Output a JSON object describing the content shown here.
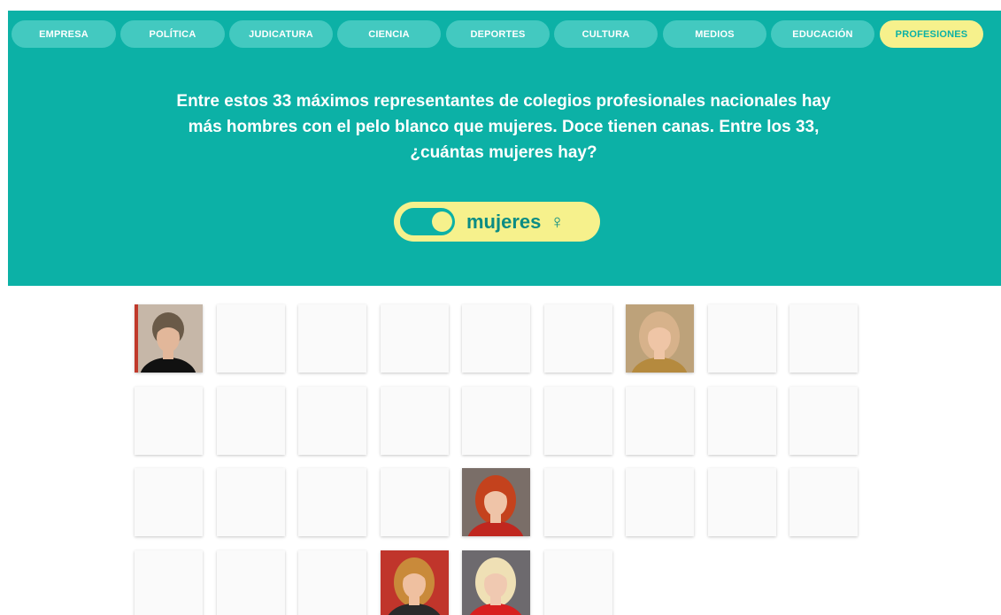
{
  "tabs": [
    {
      "label": "EMPRESA",
      "active": false
    },
    {
      "label": "POLÍTICA",
      "active": false
    },
    {
      "label": "JUDICATURA",
      "active": false
    },
    {
      "label": "CIENCIA",
      "active": false
    },
    {
      "label": "DEPORTES",
      "active": false
    },
    {
      "label": "CULTURA",
      "active": false
    },
    {
      "label": "MEDIOS",
      "active": false
    },
    {
      "label": "EDUCACIÓN",
      "active": false
    },
    {
      "label": "PROFESIONES",
      "active": true
    }
  ],
  "question": "Entre estos 33 máximos representantes de colegios profesionales nacionales hay más hombres con el pelo blanco que mujeres. Doce tienen canas. Entre los 33, ¿cuántas mujeres hay?",
  "toggle": {
    "label": "mujeres",
    "icon": "female-sign-icon",
    "glyph": "♀",
    "on": true
  },
  "grid": {
    "total": 33,
    "revealed": [
      0,
      6,
      22,
      30,
      31
    ]
  },
  "colors": {
    "teal": "#0cb1a6",
    "tab": "#43c9c0",
    "highlight": "#f6f18c"
  }
}
